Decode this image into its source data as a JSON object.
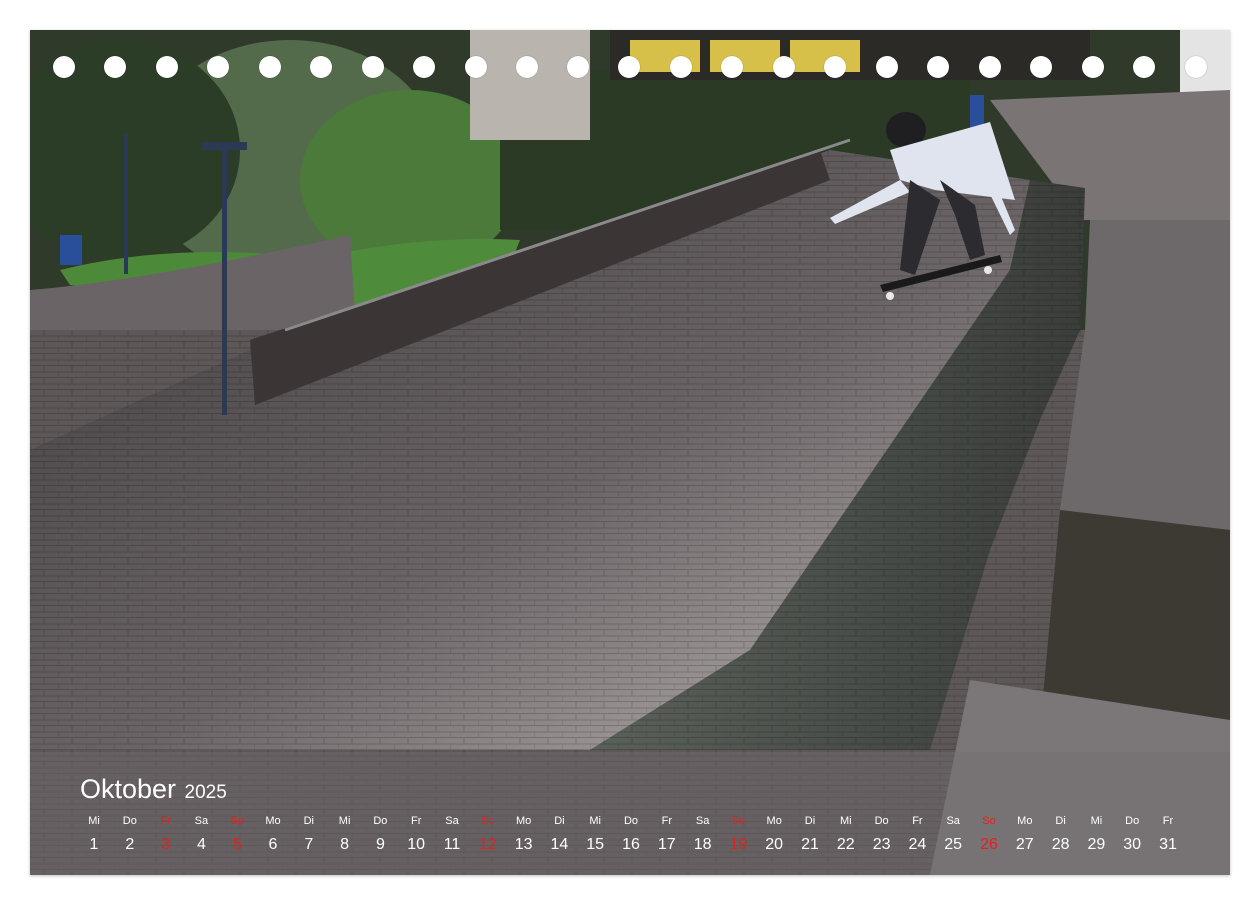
{
  "calendar": {
    "month": "Oktober",
    "year": "2025",
    "holiday_color": "#e0231c",
    "days": [
      {
        "wd": "Mi",
        "n": "1",
        "red": false
      },
      {
        "wd": "Do",
        "n": "2",
        "red": false
      },
      {
        "wd": "Fr",
        "n": "3",
        "red": true
      },
      {
        "wd": "Sa",
        "n": "4",
        "red": false
      },
      {
        "wd": "So",
        "n": "5",
        "red": true
      },
      {
        "wd": "Mo",
        "n": "6",
        "red": false
      },
      {
        "wd": "Di",
        "n": "7",
        "red": false
      },
      {
        "wd": "Mi",
        "n": "8",
        "red": false
      },
      {
        "wd": "Do",
        "n": "9",
        "red": false
      },
      {
        "wd": "Fr",
        "n": "10",
        "red": false
      },
      {
        "wd": "Sa",
        "n": "11",
        "red": false
      },
      {
        "wd": "So",
        "n": "12",
        "red": true
      },
      {
        "wd": "Mo",
        "n": "13",
        "red": false
      },
      {
        "wd": "Di",
        "n": "14",
        "red": false
      },
      {
        "wd": "Mi",
        "n": "15",
        "red": false
      },
      {
        "wd": "Do",
        "n": "16",
        "red": false
      },
      {
        "wd": "Fr",
        "n": "17",
        "red": false
      },
      {
        "wd": "Sa",
        "n": "18",
        "red": false
      },
      {
        "wd": "So",
        "n": "19",
        "red": true
      },
      {
        "wd": "Mo",
        "n": "20",
        "red": false
      },
      {
        "wd": "Di",
        "n": "21",
        "red": false
      },
      {
        "wd": "Mi",
        "n": "22",
        "red": false
      },
      {
        "wd": "Do",
        "n": "23",
        "red": false
      },
      {
        "wd": "Fr",
        "n": "24",
        "red": false
      },
      {
        "wd": "Sa",
        "n": "25",
        "red": false
      },
      {
        "wd": "So",
        "n": "26",
        "red": true
      },
      {
        "wd": "Mo",
        "n": "27",
        "red": false
      },
      {
        "wd": "Di",
        "n": "28",
        "red": false
      },
      {
        "wd": "Mi",
        "n": "29",
        "red": false
      },
      {
        "wd": "Do",
        "n": "30",
        "red": false
      },
      {
        "wd": "Fr",
        "n": "31",
        "red": false
      }
    ]
  },
  "photo": {
    "subject": "skateboarder on brick wall ramp"
  }
}
